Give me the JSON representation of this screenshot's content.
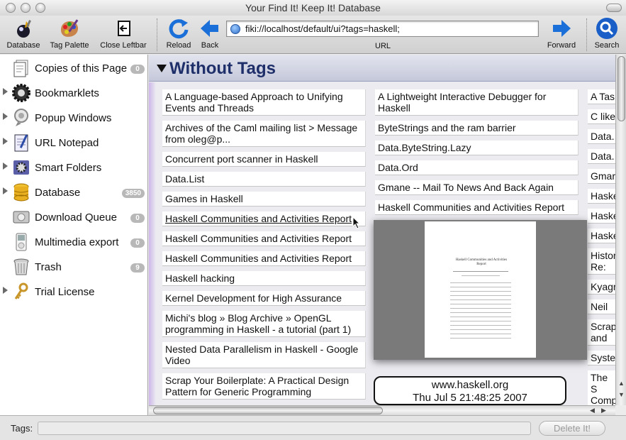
{
  "window": {
    "title": "Your Find It! Keep It! Database"
  },
  "toolbar": {
    "database": "Database",
    "tag_palette": "Tag Palette",
    "close_leftbar": "Close Leftbar",
    "reload": "Reload",
    "back": "Back",
    "url_value": "fiki://localhost/default/ui?tags=haskell;",
    "url_label": "URL",
    "forward": "Forward",
    "search": "Search"
  },
  "sidebar": {
    "items": [
      {
        "label": "Copies of this Page",
        "badge": "0",
        "icon": "copies-icon"
      },
      {
        "label": "Bookmarklets",
        "badge": "",
        "icon": "gear-icon"
      },
      {
        "label": "Popup Windows",
        "badge": "",
        "icon": "popup-icon"
      },
      {
        "label": "URL Notepad",
        "badge": "",
        "icon": "notepad-icon"
      },
      {
        "label": "Smart Folders",
        "badge": "",
        "icon": "smart-folder-icon"
      },
      {
        "label": "Database",
        "badge": "3850",
        "icon": "database-icon"
      },
      {
        "label": "Download Queue",
        "badge": "0",
        "icon": "disk-icon"
      },
      {
        "label": "Multimedia export",
        "badge": "0",
        "icon": "ipod-icon"
      },
      {
        "label": "Trash",
        "badge": "9",
        "icon": "trash-icon"
      },
      {
        "label": "Trial License",
        "badge": "",
        "icon": "key-icon"
      }
    ]
  },
  "main": {
    "section_title": "Without Tags",
    "col1": [
      "A Language-based Approach to Unifying Events and Threads",
      "Archives of the Caml mailing list > Message from oleg@p...",
      "Concurrent port scanner in Haskell",
      "Data.List",
      "Games in Haskell",
      "Haskell Communities and Activities Report",
      "Haskell Communities and Activities Report",
      "Haskell Communities and Activities Report",
      "Haskell hacking",
      "Kernel Development for High Assurance",
      "Michi's blog » Blog Archive » OpenGL programming in Haskell - a tutorial (part 1)",
      "Nested Data Parallelism in Haskell - Google Video",
      "Scrap Your Boilerplate: A Practical Design Pattern for Generic Programming"
    ],
    "col2": [
      "A Lightweight Interactive Debugger for Haskell",
      "ByteStrings and the ram barrier",
      "Data.ByteString.Lazy",
      "Data.Ord",
      "Gmane -- Mail To News And Back Again",
      "Haskell Communities and Activities Report"
    ],
    "col3": [
      "A Tas",
      "C like",
      "Data.",
      "Data.",
      "Gmar",
      "Haske",
      "Haske",
      "Haske",
      "Histor Re: [H",
      "Kyagr",
      "Neil M",
      "Scrap and G",
      "Syste",
      "The S Comp Comp"
    ],
    "preview": {
      "doc_title": "Haskell Communities and Activities Report",
      "host": "www.haskell.org",
      "date": "Thu Jul 5 21:48:25 2007"
    }
  },
  "bottom": {
    "tags_label": "Tags:",
    "tags_value": "",
    "delete_button": "Delete It!"
  }
}
